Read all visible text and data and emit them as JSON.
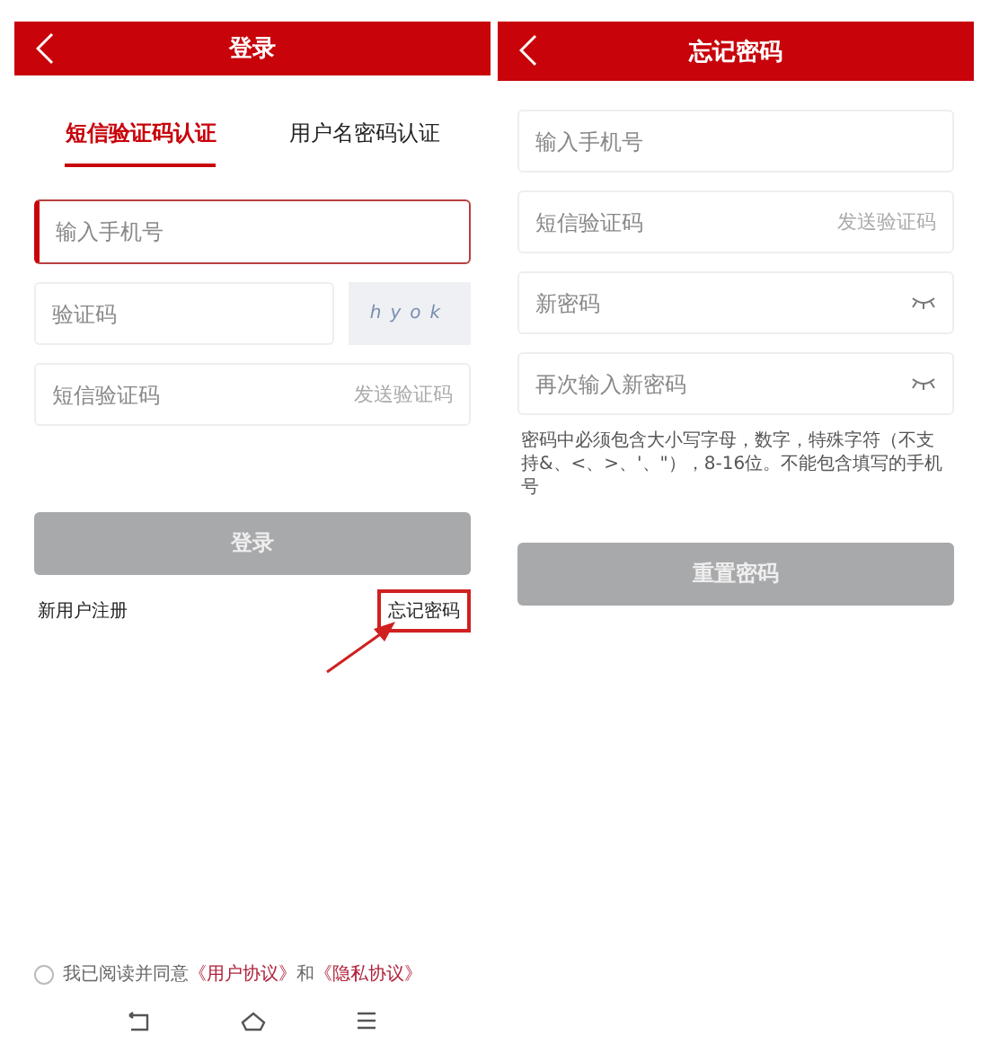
{
  "login_screen": {
    "title": "登录",
    "tabs": [
      {
        "label": "短信验证码认证",
        "selected": true
      },
      {
        "label": "用户名密码认证",
        "selected": false
      }
    ],
    "phone_field": {
      "placeholder": "输入手机号",
      "focused": true
    },
    "captcha_field": {
      "placeholder": "验证码"
    },
    "captcha_text": "hyok",
    "sms_field": {
      "placeholder": "短信验证码",
      "action": "发送验证码"
    },
    "login_button": {
      "label": "登录",
      "disabled": true
    },
    "register_link": "新用户注册",
    "forgot_link": {
      "label": "忘记密码",
      "annotated": true
    },
    "agreement": {
      "checked": false,
      "text": "我已阅读并同意",
      "links": [
        "《用户协议》",
        "《隐私协议》"
      ],
      "conjunction": "和"
    }
  },
  "reset_screen": {
    "title": "忘记密码",
    "fields": [
      {
        "kind": "text",
        "placeholder": "输入手机号"
      },
      {
        "kind": "sms",
        "placeholder": "短信验证码",
        "action": "发送验证码"
      },
      {
        "kind": "password",
        "placeholder": "新密码"
      },
      {
        "kind": "password",
        "placeholder": "再次输入新密码"
      }
    ],
    "hint": "密码中必须包含大小写字母，数字，特殊字符（不支持&、<、>、'、\"），8-16位。不能包含填写的手机号",
    "button": {
      "label": "重置密码",
      "disabled": true
    }
  }
}
